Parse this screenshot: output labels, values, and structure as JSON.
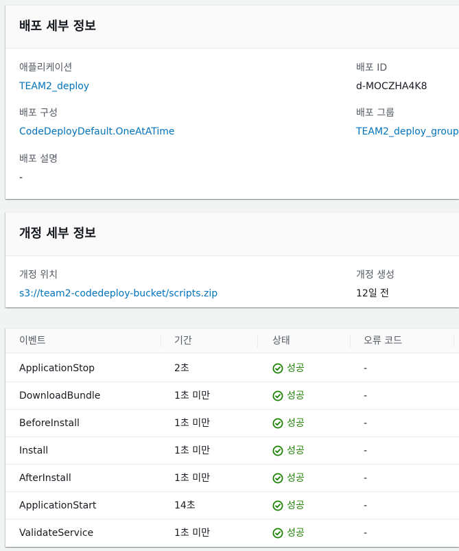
{
  "deployment": {
    "title": "배포 세부 정보",
    "application_label": "애플리케이션",
    "application_value": "TEAM2_deploy",
    "deployment_id_label": "배포 ID",
    "deployment_id_value": "d-MOCZHA4K8",
    "config_label": "배포 구성",
    "config_value": "CodeDeployDefault.OneAtATime",
    "group_label": "배포 그룹",
    "group_value": "TEAM2_deploy_group",
    "description_label": "배포 설명",
    "description_value": "-"
  },
  "revision": {
    "title": "개정 세부 정보",
    "location_label": "개정 위치",
    "location_value": "s3://team2-codedeploy-bucket/scripts.zip",
    "created_label": "개정 생성",
    "created_value": "12일 전"
  },
  "events": {
    "columns": [
      "이벤트",
      "기간",
      "상태",
      "오류 코드"
    ],
    "rows": [
      {
        "event": "ApplicationStop",
        "duration": "2초",
        "status": "성공",
        "error": "-"
      },
      {
        "event": "DownloadBundle",
        "duration": "1초 미만",
        "status": "성공",
        "error": "-"
      },
      {
        "event": "BeforeInstall",
        "duration": "1초 미만",
        "status": "성공",
        "error": "-"
      },
      {
        "event": "Install",
        "duration": "1초 미만",
        "status": "성공",
        "error": "-"
      },
      {
        "event": "AfterInstall",
        "duration": "1초 미만",
        "status": "성공",
        "error": "-"
      },
      {
        "event": "ApplicationStart",
        "duration": "14초",
        "status": "성공",
        "error": "-"
      },
      {
        "event": "ValidateService",
        "duration": "1초 미만",
        "status": "성공",
        "error": "-"
      }
    ]
  },
  "colors": {
    "link": "#0073bb",
    "success": "#1d8102",
    "header_bg": "#fafafa",
    "page_bg": "#f2f3f3"
  },
  "icons": {
    "status": "check-circle-icon"
  }
}
